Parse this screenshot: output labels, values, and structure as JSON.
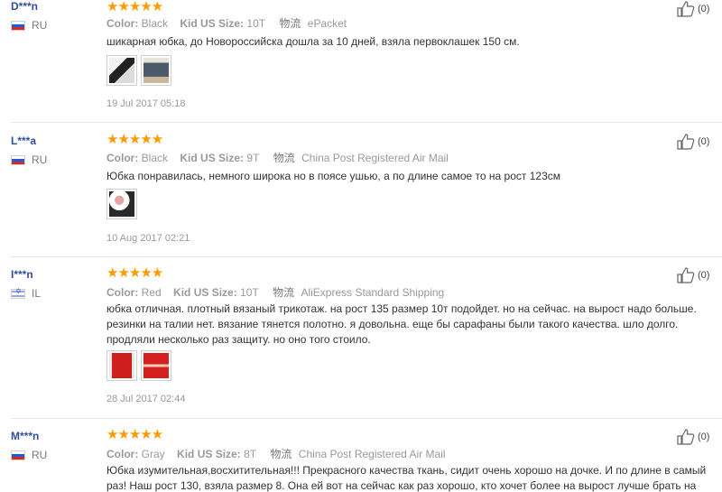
{
  "labels": {
    "color": "Color:",
    "size": "Kid US Size:",
    "logistics": "物流"
  },
  "reviews": [
    {
      "user": "D***n",
      "country": "RU",
      "stars": "★★★★★",
      "color": "Black",
      "size": "10T",
      "shipping": "ePacket",
      "text": "шикарная юбка, до Новороссийска дошла за 10 дней, взяла первоклашек 150 см.",
      "date": "19 Jul 2017 05:18",
      "helpful": "(0)"
    },
    {
      "user": "L***a",
      "country": "RU",
      "stars": "★★★★★",
      "color": "Black",
      "size": "9T",
      "shipping": "China Post Registered Air Mail",
      "text": "Юбка понравилась, немного широка но в поясе ушью, а по длине самое то на рост 123см",
      "date": "10 Aug 2017 02:21",
      "helpful": "(0)"
    },
    {
      "user": "I***n",
      "country": "IL",
      "stars": "★★★★★",
      "color": "Red",
      "size": "10T",
      "shipping": "AliExpress Standard Shipping",
      "text": "юбка отличная. плотный вязаный трикотаж. на рост 135 размер 10т подойдет. но на сейчас. на вырост надо больше. резинки на талии нет. вязание тянется полотно. я довольна. еще бы сарафаны были такого качества. шло долго. продляли несколько раз защиту. но оно того стоило.",
      "date": "28 Jul 2017 02:44",
      "helpful": "(0)"
    },
    {
      "user": "M***n",
      "country": "RU",
      "stars": "★★★★★",
      "color": "Gray",
      "size": "8T",
      "shipping": "China Post Registered Air Mail",
      "text": "Юбка изумительная,восхитительная!!! Прекрасного качества ткань, сидит очень хорошо на дочке. И по длине в самый раз! Наш рост 130, взяла размер 8. Она ей вот на сейчас как раз хорошо, кто хочет более на вырост лучше брать на размер",
      "helpful": "(0)"
    }
  ],
  "icons": {
    "helpful": "thumbs-up-icon",
    "flag_ru": "russia-flag-icon",
    "flag_il": "israel-flag-icon"
  },
  "colors": {
    "username": "#2f4f99",
    "stars": "#ff9a00",
    "muted": "#999999"
  }
}
